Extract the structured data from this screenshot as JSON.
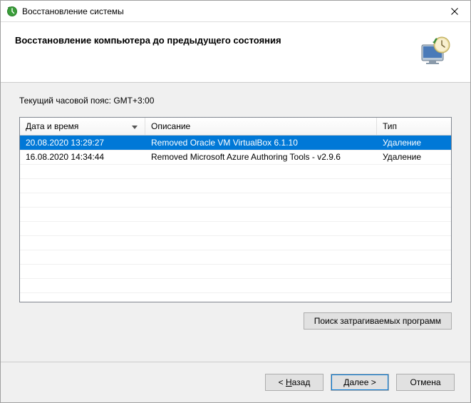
{
  "window": {
    "title": "Восстановление системы"
  },
  "header": {
    "heading": "Восстановление компьютера до предыдущего состояния"
  },
  "timezone_label": "Текущий часовой пояс: GMT+3:00",
  "columns": {
    "datetime": "Дата и время",
    "description": "Описание",
    "type": "Тип"
  },
  "rows": [
    {
      "datetime": "20.08.2020 13:29:27",
      "description": "Removed Oracle VM VirtualBox 6.1.10",
      "type": "Удаление",
      "selected": true
    },
    {
      "datetime": "16.08.2020 14:34:44",
      "description": "Removed Microsoft Azure Authoring Tools - v2.9.6",
      "type": "Удаление",
      "selected": false
    }
  ],
  "buttons": {
    "scan": "Поиск затрагиваемых программ",
    "back_prefix": "< ",
    "back_u": "Н",
    "back_rest": "азад",
    "next_u": "Д",
    "next_rest": "алее >",
    "cancel": "Отмена"
  }
}
